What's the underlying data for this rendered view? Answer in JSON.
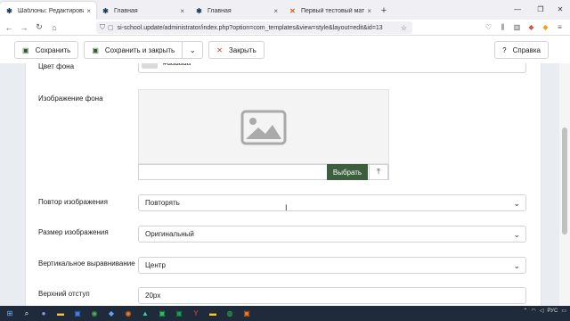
{
  "browser": {
    "tabs": [
      {
        "label": "Шаблоны: Редактирование ст",
        "favicon": "joomla-icon",
        "active": true
      },
      {
        "label": "Главная",
        "favicon": "joomla-icon",
        "active": false
      },
      {
        "label": "Главная",
        "favicon": "joomla-icon",
        "active": false
      },
      {
        "label": "Первый тестовый материал",
        "favicon": "joomla-orange-icon",
        "active": false
      }
    ],
    "new_tab": "+",
    "close": "×",
    "url": "si-school.update/administrator/index.php?option=com_templates&view=style&layout=edit&id=13"
  },
  "toolbar": {
    "save_label": "Сохранить",
    "save_close_label": "Сохранить и закрыть",
    "close_label": "Закрыть",
    "help_label": "Справка"
  },
  "form": {
    "bg_color_label": "Цвет фона",
    "bg_color_value": "#dadada",
    "bg_image_label": "Изображение фона",
    "select_label": "Выбрать",
    "repeat_label": "Повтор изображения",
    "repeat_value": "Повторять",
    "size_label": "Размер изображения",
    "size_value": "Оригинальный",
    "valign_label": "Вертикальное выравнивание",
    "valign_value": "Центр",
    "top_padding_label": "Верхний отступ",
    "top_padding_value": "20px"
  },
  "taskbar": {
    "lang": "РУС"
  },
  "colors": {
    "accent_green": "#3d5f3d",
    "swatch": "#dadada"
  }
}
